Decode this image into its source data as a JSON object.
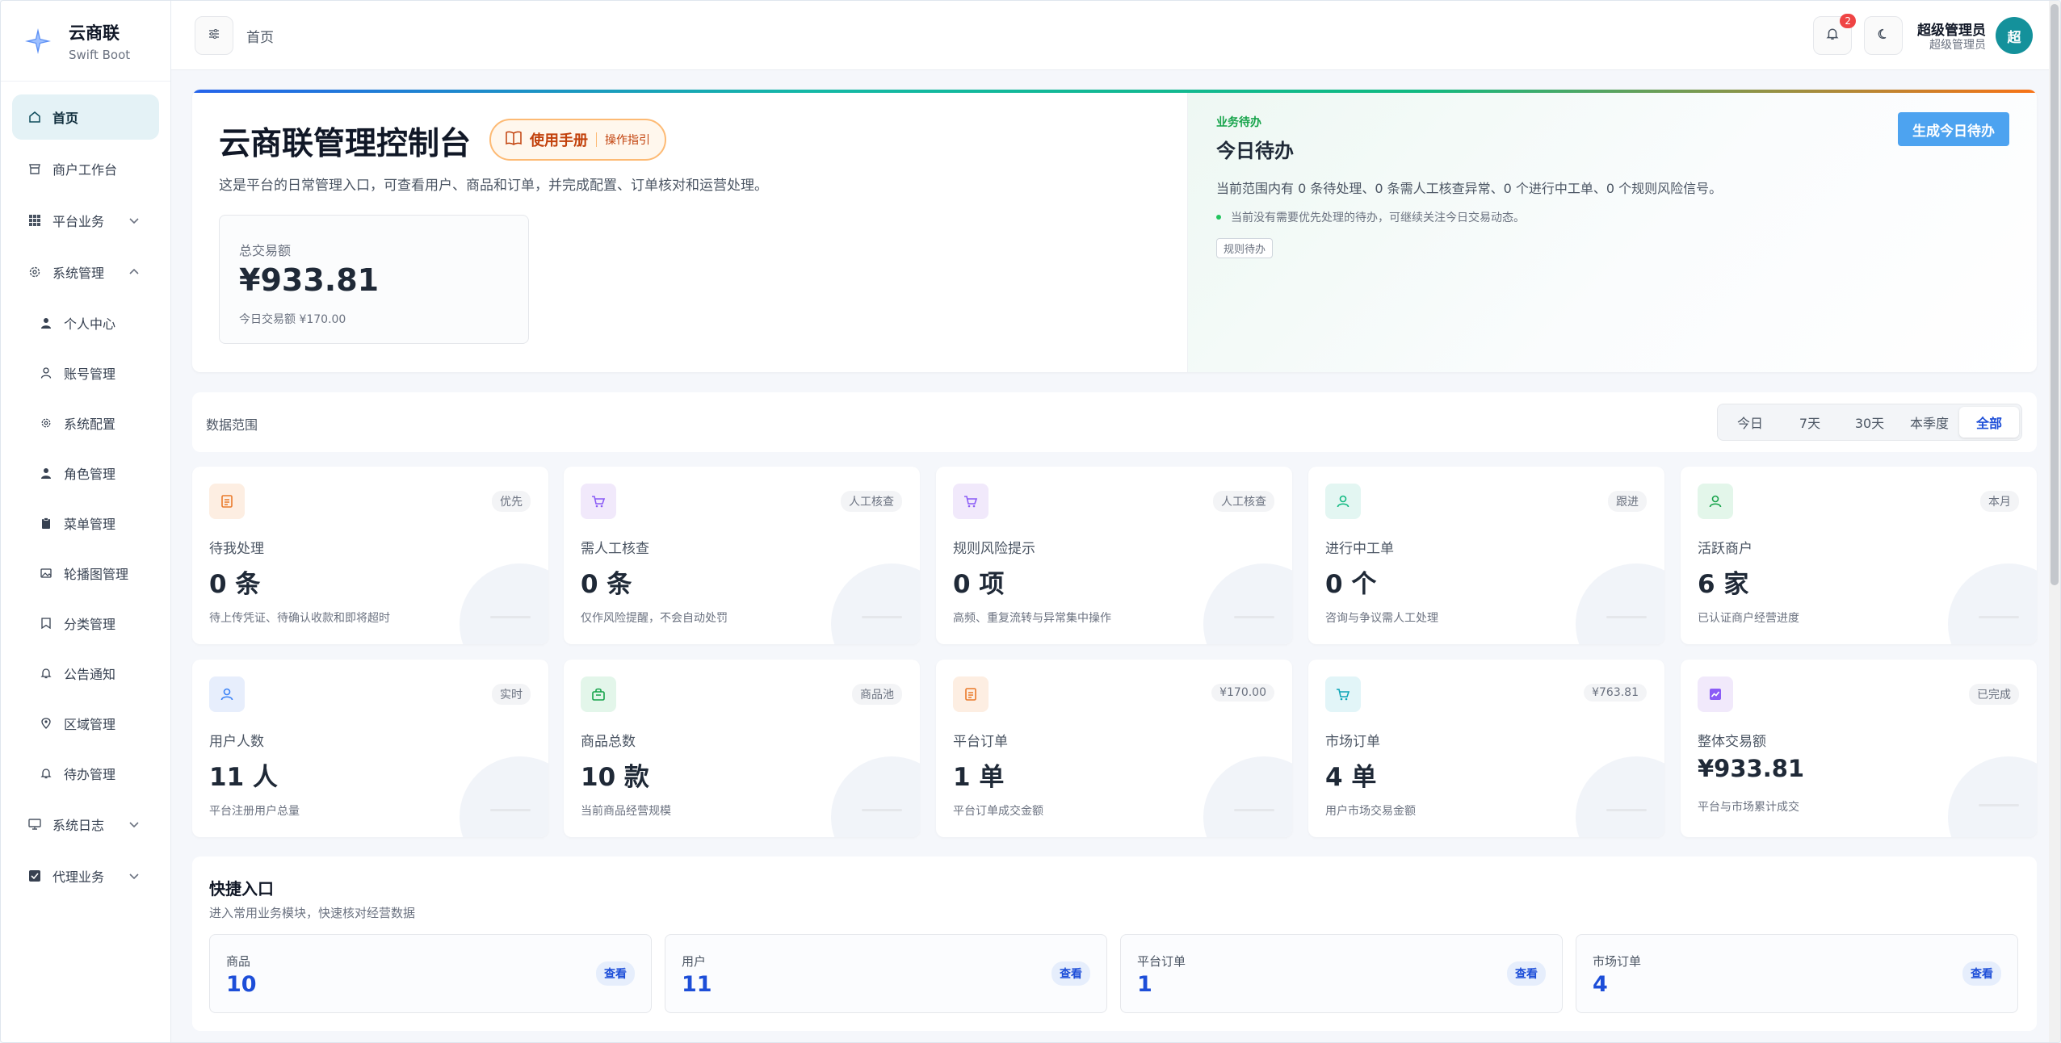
{
  "brand": {
    "name": "云商联",
    "sub": "Swift Boot"
  },
  "sidebar": {
    "items": [
      {
        "label": "首页"
      },
      {
        "label": "商户工作台"
      },
      {
        "label": "平台业务"
      },
      {
        "label": "系统管理"
      },
      {
        "label": "个人中心"
      },
      {
        "label": "账号管理"
      },
      {
        "label": "系统配置"
      },
      {
        "label": "角色管理"
      },
      {
        "label": "菜单管理"
      },
      {
        "label": "轮播图管理"
      },
      {
        "label": "分类管理"
      },
      {
        "label": "公告通知"
      },
      {
        "label": "区域管理"
      },
      {
        "label": "待办管理"
      },
      {
        "label": "系统日志"
      },
      {
        "label": "代理业务"
      }
    ]
  },
  "topbar": {
    "breadcrumb": "首页",
    "notification_count": "2",
    "user_name": "超级管理员",
    "user_role": "超级管理员",
    "avatar_text": "超"
  },
  "hero": {
    "title": "云商联管理控制台",
    "manual_label": "使用手册",
    "manual_sub": "操作指引",
    "desc": "这是平台的日常管理入口，可查看用户、商品和订单，并完成配置、订单核对和运营处理。",
    "stat_label": "总交易额",
    "stat_value": "¥933.81",
    "stat_sub": "今日交易额 ¥170.00"
  },
  "todo": {
    "tag": "业务待办",
    "title": "今日待办",
    "desc": "当前范围内有 0 条待处理、0 条需人工核查异常、0 个进行中工单、0 个规则风险信号。",
    "note": "当前没有需要优先处理的待办，可继续关注今日交易动态。",
    "chip": "规则待办",
    "button": "生成今日待办"
  },
  "range": {
    "label": "数据范围",
    "tabs": [
      "今日",
      "7天",
      "30天",
      "本季度",
      "全部"
    ],
    "selected": "全部"
  },
  "cards": [
    {
      "tag": "优先",
      "title": "待我处理",
      "value": "0 条",
      "desc": "待上传凭证、待确认收款和即将超时"
    },
    {
      "tag": "人工核查",
      "title": "需人工核查",
      "value": "0 条",
      "desc": "仅作风险提醒，不会自动处罚"
    },
    {
      "tag": "人工核查",
      "title": "规则风险提示",
      "value": "0 项",
      "desc": "高频、重复流转与异常集中操作"
    },
    {
      "tag": "跟进",
      "title": "进行中工单",
      "value": "0 个",
      "desc": "咨询与争议需人工处理"
    },
    {
      "tag": "本月",
      "title": "活跃商户",
      "value": "6 家",
      "desc": "已认证商户经营进度"
    },
    {
      "tag": "实时",
      "title": "用户人数",
      "value": "11 人",
      "desc": "平台注册用户总量"
    },
    {
      "tag": "商品池",
      "title": "商品总数",
      "value": "10 款",
      "desc": "当前商品经营规模"
    },
    {
      "tag": "¥170.00",
      "title": "平台订单",
      "value": "1 单",
      "desc": "平台订单成交金额"
    },
    {
      "tag": "¥763.81",
      "title": "市场订单",
      "value": "4 单",
      "desc": "用户市场交易金额"
    },
    {
      "tag": "已完成",
      "title": "整体交易额",
      "value": "¥933.81",
      "desc": "平台与市场累计成交"
    }
  ],
  "icons": [
    "document-icon",
    "cart-icon",
    "cart-icon",
    "user-icon",
    "user-icon",
    "user-icon",
    "bag-icon",
    "document-icon",
    "cart-icon",
    "trend-icon"
  ],
  "colors": {
    "accent": "#4da3f0",
    "active_bg": "#e4f2f6",
    "link": "#1d4ed8",
    "badge": "#ef4444",
    "avatar": "#14919b"
  },
  "quick": {
    "title": "快捷入口",
    "desc": "进入常用业务模块，快速核对经营数据",
    "items": [
      {
        "label": "商品",
        "value": "10",
        "button": "查看"
      },
      {
        "label": "用户",
        "value": "11",
        "button": "查看"
      },
      {
        "label": "平台订单",
        "value": "1",
        "button": "查看"
      },
      {
        "label": "市场订单",
        "value": "4",
        "button": "查看"
      }
    ]
  }
}
